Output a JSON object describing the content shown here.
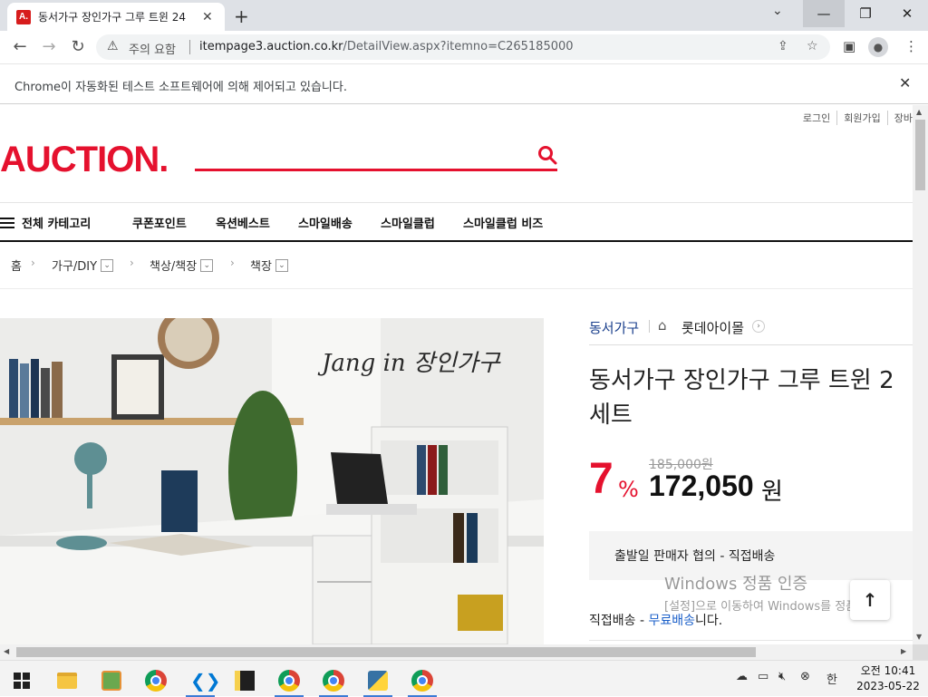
{
  "browser": {
    "tab_title": "동서가구 장인가구 그루 트윈 24",
    "favicon_letter": "A.",
    "security_label": "주의 요함",
    "url_host": "itempage3.auction.co.kr",
    "url_path": "/DetailView.aspx?itemno=C265185000",
    "infobar_text": "Chrome이 자동화된 테스트 소프트웨어에 의해 제어되고 있습니다."
  },
  "header": {
    "util_links": [
      "로그인",
      "회원가입",
      "장바"
    ],
    "logo": "AUCTION."
  },
  "gnb": {
    "all_categories": "전체 카테고리",
    "items": [
      "쿠폰포인트",
      "옥션베스트",
      "스마일배송",
      "스마일클럽",
      "스마일클럽 비즈"
    ]
  },
  "breadcrumb": {
    "home": "홈",
    "levels": [
      "가구/DIY",
      "책상/책장",
      "책장"
    ]
  },
  "product": {
    "brand_text": "Jang in 장인가구",
    "seller": "동서가구",
    "shop": "롯데아이몰",
    "title_line1": "동서가구 장인가구 그루 트윈 2",
    "title_line2": "세트",
    "discount": "7",
    "discount_unit": "%",
    "original_price": "185,000원",
    "price": "172,050",
    "price_unit": "원",
    "shipping_note": "출발일 판매자 협의 - 직접배송",
    "delivery_label": "직접배송 - ",
    "delivery_free": "무료배송",
    "delivery_suffix": "니다."
  },
  "watermark": {
    "title": "Windows 정품 인증",
    "subtitle": "[설정]으로 이동하여 Windows를 정품"
  },
  "taskbar": {
    "time": "오전 10:41",
    "date": "2023-05-22",
    "ime": "한"
  },
  "colors": {
    "brand_red": "#e5112e",
    "link_blue": "#1a5fc9"
  }
}
